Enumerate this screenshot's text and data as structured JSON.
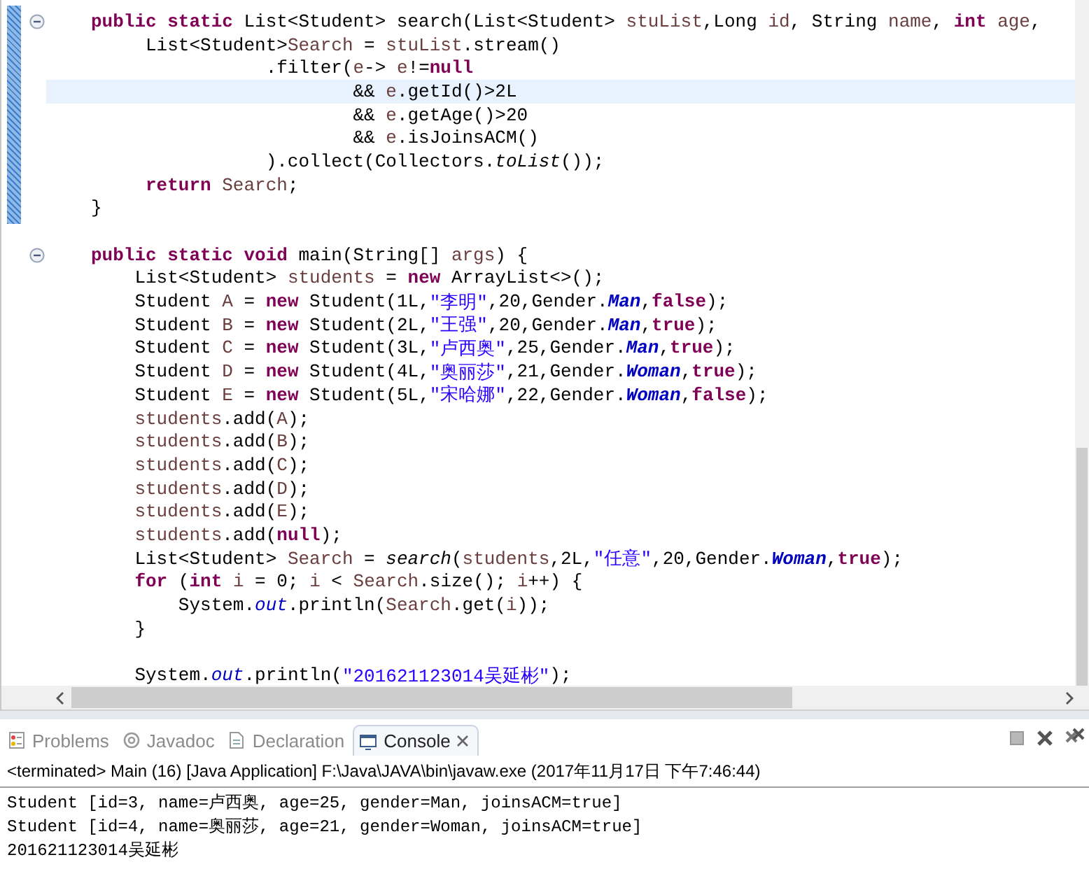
{
  "editor": {
    "lines": [
      {
        "fold_marker": true,
        "current": false,
        "tokens": [
          {
            "kind": "keyword",
            "text": "public static "
          },
          {
            "kind": "plain",
            "text": "List<Student> search(List<Student> "
          },
          {
            "kind": "variable",
            "text": "stuList"
          },
          {
            "kind": "plain",
            "text": ",Long "
          },
          {
            "kind": "variable",
            "text": "id"
          },
          {
            "kind": "plain",
            "text": ", String "
          },
          {
            "kind": "variable",
            "text": "name"
          },
          {
            "kind": "plain",
            "text": ", "
          },
          {
            "kind": "keyword",
            "text": "int "
          },
          {
            "kind": "variable",
            "text": "age"
          },
          {
            "kind": "plain",
            "text": ","
          }
        ]
      },
      {
        "fold_marker": false,
        "current": false,
        "tokens": [
          {
            "kind": "plain",
            "text": "     List<Student>"
          },
          {
            "kind": "variable",
            "text": "Search"
          },
          {
            "kind": "plain",
            "text": " = "
          },
          {
            "kind": "variable",
            "text": "stuList"
          },
          {
            "kind": "plain",
            "text": ".stream()"
          }
        ]
      },
      {
        "fold_marker": false,
        "current": false,
        "tokens": [
          {
            "kind": "plain",
            "text": "                .filter("
          },
          {
            "kind": "variable",
            "text": "e"
          },
          {
            "kind": "plain",
            "text": "-> "
          },
          {
            "kind": "variable",
            "text": "e"
          },
          {
            "kind": "plain",
            "text": "!="
          },
          {
            "kind": "keyword",
            "text": "null"
          }
        ]
      },
      {
        "fold_marker": false,
        "current": true,
        "tokens": [
          {
            "kind": "plain",
            "text": "                        && "
          },
          {
            "kind": "variable",
            "text": "e"
          },
          {
            "kind": "plain",
            "text": ".getId()>2L"
          }
        ]
      },
      {
        "fold_marker": false,
        "current": false,
        "tokens": [
          {
            "kind": "plain",
            "text": "                        && "
          },
          {
            "kind": "variable",
            "text": "e"
          },
          {
            "kind": "plain",
            "text": ".getAge()>20"
          }
        ]
      },
      {
        "fold_marker": false,
        "current": false,
        "tokens": [
          {
            "kind": "plain",
            "text": "                        && "
          },
          {
            "kind": "variable",
            "text": "e"
          },
          {
            "kind": "plain",
            "text": ".isJoinsACM()"
          }
        ]
      },
      {
        "fold_marker": false,
        "current": false,
        "tokens": [
          {
            "kind": "plain",
            "text": "                ).collect(Collectors."
          },
          {
            "kind": "static_method",
            "text": "toList"
          },
          {
            "kind": "plain",
            "text": "());"
          }
        ]
      },
      {
        "fold_marker": false,
        "current": false,
        "tokens": [
          {
            "kind": "keyword",
            "text": "     return "
          },
          {
            "kind": "variable",
            "text": "Search"
          },
          {
            "kind": "plain",
            "text": ";"
          }
        ]
      },
      {
        "fold_marker": false,
        "current": false,
        "tokens": [
          {
            "kind": "plain",
            "text": "}"
          }
        ]
      },
      {
        "fold_marker": false,
        "current": false
      },
      {
        "fold_marker": true,
        "current": false,
        "tokens": [
          {
            "kind": "keyword",
            "text": "public static void "
          },
          {
            "kind": "plain",
            "text": "main(String[] "
          },
          {
            "kind": "variable",
            "text": "args"
          },
          {
            "kind": "plain",
            "text": ") {"
          }
        ]
      },
      {
        "fold_marker": false,
        "current": false,
        "tokens": [
          {
            "kind": "plain",
            "text": "    List<Student> "
          },
          {
            "kind": "variable",
            "text": "students"
          },
          {
            "kind": "plain",
            "text": " = "
          },
          {
            "kind": "keyword",
            "text": "new"
          },
          {
            "kind": "plain",
            "text": " ArrayList<>();"
          }
        ]
      },
      {
        "fold_marker": false,
        "current": false,
        "tokens": [
          {
            "kind": "plain",
            "text": "    Student "
          },
          {
            "kind": "variable",
            "text": "A"
          },
          {
            "kind": "plain",
            "text": " = "
          },
          {
            "kind": "keyword",
            "text": "new"
          },
          {
            "kind": "plain",
            "text": " Student(1L,"
          },
          {
            "kind": "string",
            "text": "\"李明\""
          },
          {
            "kind": "plain",
            "text": ",20,Gender."
          },
          {
            "kind": "enum_constant",
            "text": "Man"
          },
          {
            "kind": "plain",
            "text": ","
          },
          {
            "kind": "keyword",
            "text": "false"
          },
          {
            "kind": "plain",
            "text": ");"
          }
        ]
      },
      {
        "fold_marker": false,
        "current": false,
        "tokens": [
          {
            "kind": "plain",
            "text": "    Student "
          },
          {
            "kind": "variable",
            "text": "B"
          },
          {
            "kind": "plain",
            "text": " = "
          },
          {
            "kind": "keyword",
            "text": "new"
          },
          {
            "kind": "plain",
            "text": " Student(2L,"
          },
          {
            "kind": "string",
            "text": "\"王强\""
          },
          {
            "kind": "plain",
            "text": ",20,Gender."
          },
          {
            "kind": "enum_constant",
            "text": "Man"
          },
          {
            "kind": "plain",
            "text": ","
          },
          {
            "kind": "keyword",
            "text": "true"
          },
          {
            "kind": "plain",
            "text": ");"
          }
        ]
      },
      {
        "fold_marker": false,
        "current": false,
        "tokens": [
          {
            "kind": "plain",
            "text": "    Student "
          },
          {
            "kind": "variable",
            "text": "C"
          },
          {
            "kind": "plain",
            "text": " = "
          },
          {
            "kind": "keyword",
            "text": "new"
          },
          {
            "kind": "plain",
            "text": " Student(3L,"
          },
          {
            "kind": "string",
            "text": "\"卢西奥\""
          },
          {
            "kind": "plain",
            "text": ",25,Gender."
          },
          {
            "kind": "enum_constant",
            "text": "Man"
          },
          {
            "kind": "plain",
            "text": ","
          },
          {
            "kind": "keyword",
            "text": "true"
          },
          {
            "kind": "plain",
            "text": ");"
          }
        ]
      },
      {
        "fold_marker": false,
        "current": false,
        "tokens": [
          {
            "kind": "plain",
            "text": "    Student "
          },
          {
            "kind": "variable",
            "text": "D"
          },
          {
            "kind": "plain",
            "text": " = "
          },
          {
            "kind": "keyword",
            "text": "new"
          },
          {
            "kind": "plain",
            "text": " Student(4L,"
          },
          {
            "kind": "string",
            "text": "\"奥丽莎\""
          },
          {
            "kind": "plain",
            "text": ",21,Gender."
          },
          {
            "kind": "enum_constant",
            "text": "Woman"
          },
          {
            "kind": "plain",
            "text": ","
          },
          {
            "kind": "keyword",
            "text": "true"
          },
          {
            "kind": "plain",
            "text": ");"
          }
        ]
      },
      {
        "fold_marker": false,
        "current": false,
        "tokens": [
          {
            "kind": "plain",
            "text": "    Student "
          },
          {
            "kind": "variable",
            "text": "E"
          },
          {
            "kind": "plain",
            "text": " = "
          },
          {
            "kind": "keyword",
            "text": "new"
          },
          {
            "kind": "plain",
            "text": " Student(5L,"
          },
          {
            "kind": "string",
            "text": "\"宋哈娜\""
          },
          {
            "kind": "plain",
            "text": ",22,Gender."
          },
          {
            "kind": "enum_constant",
            "text": "Woman"
          },
          {
            "kind": "plain",
            "text": ","
          },
          {
            "kind": "keyword",
            "text": "false"
          },
          {
            "kind": "plain",
            "text": ");"
          }
        ]
      },
      {
        "fold_marker": false,
        "current": false,
        "tokens": [
          {
            "kind": "variable",
            "text": "    students"
          },
          {
            "kind": "plain",
            "text": ".add("
          },
          {
            "kind": "variable",
            "text": "A"
          },
          {
            "kind": "plain",
            "text": ");"
          }
        ]
      },
      {
        "fold_marker": false,
        "current": false,
        "tokens": [
          {
            "kind": "variable",
            "text": "    students"
          },
          {
            "kind": "plain",
            "text": ".add("
          },
          {
            "kind": "variable",
            "text": "B"
          },
          {
            "kind": "plain",
            "text": ");"
          }
        ]
      },
      {
        "fold_marker": false,
        "current": false,
        "tokens": [
          {
            "kind": "variable",
            "text": "    students"
          },
          {
            "kind": "plain",
            "text": ".add("
          },
          {
            "kind": "variable",
            "text": "C"
          },
          {
            "kind": "plain",
            "text": ");"
          }
        ]
      },
      {
        "fold_marker": false,
        "current": false,
        "tokens": [
          {
            "kind": "variable",
            "text": "    students"
          },
          {
            "kind": "plain",
            "text": ".add("
          },
          {
            "kind": "variable",
            "text": "D"
          },
          {
            "kind": "plain",
            "text": ");"
          }
        ]
      },
      {
        "fold_marker": false,
        "current": false,
        "tokens": [
          {
            "kind": "variable",
            "text": "    students"
          },
          {
            "kind": "plain",
            "text": ".add("
          },
          {
            "kind": "variable",
            "text": "E"
          },
          {
            "kind": "plain",
            "text": ");"
          }
        ]
      },
      {
        "fold_marker": false,
        "current": false,
        "tokens": [
          {
            "kind": "variable",
            "text": "    students"
          },
          {
            "kind": "plain",
            "text": ".add("
          },
          {
            "kind": "keyword",
            "text": "null"
          },
          {
            "kind": "plain",
            "text": ");"
          }
        ]
      },
      {
        "fold_marker": false,
        "current": false,
        "tokens": [
          {
            "kind": "plain",
            "text": "    List<Student> "
          },
          {
            "kind": "variable",
            "text": "Search"
          },
          {
            "kind": "plain",
            "text": " = "
          },
          {
            "kind": "static_method",
            "text": "search"
          },
          {
            "kind": "plain",
            "text": "("
          },
          {
            "kind": "variable",
            "text": "students"
          },
          {
            "kind": "plain",
            "text": ",2L,"
          },
          {
            "kind": "string",
            "text": "\"任意\""
          },
          {
            "kind": "plain",
            "text": ",20,Gender."
          },
          {
            "kind": "enum_constant",
            "text": "Woman"
          },
          {
            "kind": "plain",
            "text": ","
          },
          {
            "kind": "keyword",
            "text": "true"
          },
          {
            "kind": "plain",
            "text": ");"
          }
        ]
      },
      {
        "fold_marker": false,
        "current": false,
        "tokens": [
          {
            "kind": "keyword",
            "text": "    for"
          },
          {
            "kind": "plain",
            "text": " ("
          },
          {
            "kind": "keyword",
            "text": "int "
          },
          {
            "kind": "variable",
            "text": "i"
          },
          {
            "kind": "plain",
            "text": " = 0; "
          },
          {
            "kind": "variable",
            "text": "i"
          },
          {
            "kind": "plain",
            "text": " < "
          },
          {
            "kind": "variable",
            "text": "Search"
          },
          {
            "kind": "plain",
            "text": ".size(); "
          },
          {
            "kind": "variable",
            "text": "i"
          },
          {
            "kind": "plain",
            "text": "++) {"
          }
        ]
      },
      {
        "fold_marker": false,
        "current": false,
        "tokens": [
          {
            "kind": "plain",
            "text": "        System."
          },
          {
            "kind": "static_field",
            "text": "out"
          },
          {
            "kind": "plain",
            "text": ".println("
          },
          {
            "kind": "variable",
            "text": "Search"
          },
          {
            "kind": "plain",
            "text": ".get("
          },
          {
            "kind": "variable",
            "text": "i"
          },
          {
            "kind": "plain",
            "text": "));"
          }
        ]
      },
      {
        "fold_marker": false,
        "current": false,
        "tokens": [
          {
            "kind": "plain",
            "text": "    }"
          }
        ]
      },
      {
        "fold_marker": false,
        "current": false
      },
      {
        "fold_marker": false,
        "current": false,
        "tokens": [
          {
            "kind": "plain",
            "text": "    System."
          },
          {
            "kind": "static_field",
            "text": "out"
          },
          {
            "kind": "plain",
            "text": ".println("
          },
          {
            "kind": "string",
            "text": "\"201621123014吴延彬\""
          },
          {
            "kind": "plain",
            "text": ");"
          }
        ]
      }
    ]
  },
  "panel": {
    "tabs": [
      {
        "kind": "problems",
        "label": "Problems",
        "selected": false,
        "closable": false
      },
      {
        "kind": "javadoc",
        "label": "Javadoc",
        "selected": false,
        "closable": false
      },
      {
        "kind": "declaration",
        "label": "Declaration",
        "selected": false,
        "closable": false
      },
      {
        "kind": "console",
        "label": "Console",
        "selected": true,
        "closable": true
      }
    ],
    "console": {
      "header": "<terminated> Main (16) [Java Application] F:\\Java\\JAVA\\bin\\javaw.exe (2017年11月17日 下午7:46:44)",
      "output": [
        "Student [id=3, name=卢西奥, age=25, gender=Man, joinsACM=true]",
        "Student [id=4, name=奥丽莎, age=21, gender=Woman, joinsACM=true]",
        "201621123014吴延彬"
      ]
    }
  }
}
